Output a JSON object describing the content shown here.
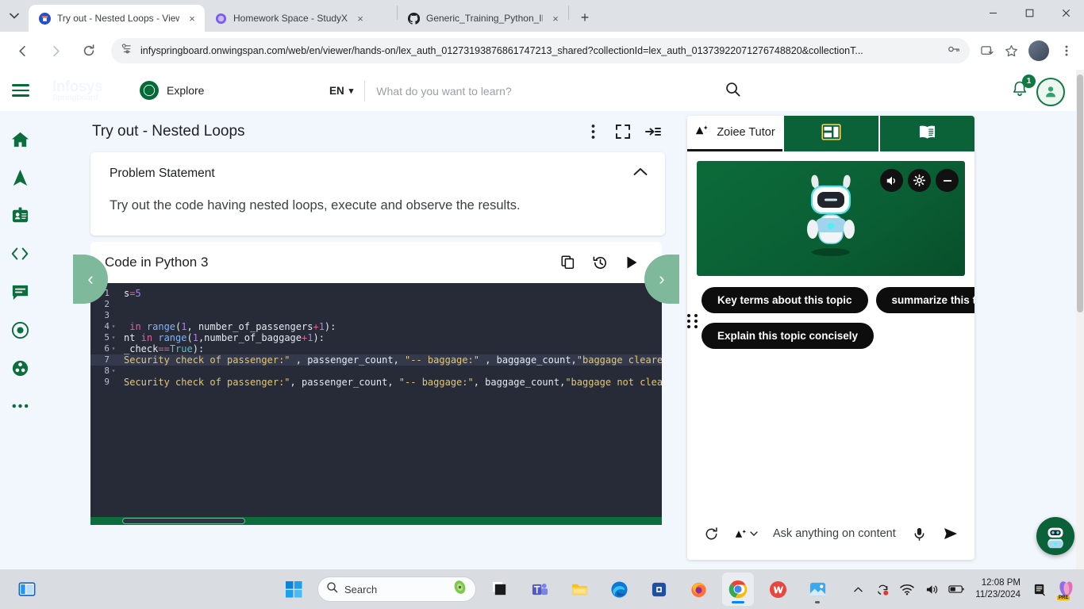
{
  "browser": {
    "tabs": [
      {
        "title": "Try out - Nested Loops - Viewer",
        "favicon": "infosys-springboard-icon",
        "active": true,
        "close_label": "×"
      },
      {
        "title": "Homework Space - StudyX",
        "favicon": "studyx-icon",
        "active": false,
        "close_label": "×"
      },
      {
        "title": "Generic_Training_Python_INFY/P",
        "favicon": "github-icon",
        "active": false,
        "close_label": "×"
      }
    ],
    "new_tab_label": "+",
    "window_controls": {
      "minimize": "—",
      "maximize": "☐",
      "close": "✕"
    },
    "url": "infyspringboard.onwingspan.com/web/en/viewer/hands-on/lex_auth_01273193876861747213_shared?collectionId=lex_auth_01373922071276748820&collectionT...",
    "nav": {
      "back": "back-arrow-icon",
      "forward": "forward-arrow-icon",
      "reload": "reload-icon"
    },
    "omnibox_icons": [
      "site-settings-icon",
      "password-key-icon"
    ],
    "toolbar_icons": [
      "install-app-icon",
      "bookmark-star-icon",
      "profile-avatar",
      "chrome-menu-icon"
    ]
  },
  "app": {
    "brand_line1": "Infosys",
    "brand_line2": "Springboard",
    "menu_icon": "hamburger-menu-icon",
    "explore_label": "Explore",
    "explore_icon": "compass-icon",
    "language": "EN",
    "language_caret": "▾",
    "search_placeholder": "What do you want to learn?",
    "search_value": "",
    "search_icon": "search-icon",
    "notification_count": "1",
    "notification_icon": "bell-icon",
    "avatar_icon": "user-avatar"
  },
  "sidebar": {
    "items": [
      {
        "name": "home",
        "icon": "home-icon"
      },
      {
        "name": "navigate",
        "icon": "navigation-arrow-icon"
      },
      {
        "name": "credentials",
        "icon": "id-badge-icon"
      },
      {
        "name": "code",
        "icon": "code-brackets-icon"
      },
      {
        "name": "discussions",
        "icon": "chat-bubble-icon"
      },
      {
        "name": "goals",
        "icon": "target-icon"
      },
      {
        "name": "community",
        "icon": "group-icon"
      },
      {
        "name": "more",
        "icon": "more-horizontal-icon"
      }
    ]
  },
  "content": {
    "title": "Try out - Nested Loops",
    "header_icons": [
      "kebab-menu-icon",
      "fullscreen-icon",
      "collapse-panel-icon"
    ],
    "problem_statement": {
      "heading": "Problem Statement",
      "collapse_caret": "∧",
      "body": "Try out the code having nested loops, execute and observe the results."
    },
    "editor": {
      "title": "Code in Python 3",
      "toolbar_icons": [
        "copy-icon",
        "history-icon",
        "run-icon"
      ],
      "prev_label": "‹",
      "next_label": "›",
      "lines": [
        {
          "num": "1",
          "fold": "",
          "highlighted": false,
          "tokens": [
            {
              "t": "s",
              "c": "var"
            },
            {
              "t": "=",
              "c": "kw"
            },
            {
              "t": "5",
              "c": "num"
            }
          ]
        },
        {
          "num": "2",
          "fold": "",
          "highlighted": false,
          "tokens": []
        },
        {
          "num": "3",
          "fold": "",
          "highlighted": false,
          "tokens": []
        },
        {
          "num": "4",
          "fold": "▾",
          "highlighted": false,
          "tokens": [
            {
              "t": " in ",
              "c": "kw"
            },
            {
              "t": "range",
              "c": "fn"
            },
            {
              "t": "(",
              "c": "var"
            },
            {
              "t": "1",
              "c": "num"
            },
            {
              "t": ", number_of_passengers",
              "c": "var"
            },
            {
              "t": "+",
              "c": "kw"
            },
            {
              "t": "1",
              "c": "num"
            },
            {
              "t": "):",
              "c": "var"
            }
          ]
        },
        {
          "num": "5",
          "fold": "▾",
          "highlighted": false,
          "tokens": [
            {
              "t": "nt",
              "c": "var"
            },
            {
              "t": " in ",
              "c": "kw"
            },
            {
              "t": "range",
              "c": "fn"
            },
            {
              "t": "(",
              "c": "var"
            },
            {
              "t": "1",
              "c": "num"
            },
            {
              "t": ",number_of_baggage",
              "c": "var"
            },
            {
              "t": "+",
              "c": "kw"
            },
            {
              "t": "1",
              "c": "num"
            },
            {
              "t": "):",
              "c": "var"
            }
          ]
        },
        {
          "num": "6",
          "fold": "▾",
          "highlighted": false,
          "tokens": [
            {
              "t": "_check",
              "c": "var"
            },
            {
              "t": "==",
              "c": "kw"
            },
            {
              "t": "True",
              "c": "bool"
            },
            {
              "t": "):",
              "c": "var"
            }
          ]
        },
        {
          "num": "7",
          "fold": "",
          "highlighted": true,
          "tokens": [
            {
              "t": "Security check of passenger:\" ",
              "c": "str"
            },
            {
              "t": ", passenger_count, ",
              "c": "var"
            },
            {
              "t": "\"-- baggage:\" ",
              "c": "str"
            },
            {
              "t": ", baggage_count,",
              "c": "var"
            },
            {
              "t": "\"baggage cleared\"",
              "c": "str"
            },
            {
              "t": ")",
              "c": "var"
            }
          ]
        },
        {
          "num": "8",
          "fold": "▾",
          "highlighted": false,
          "tokens": []
        },
        {
          "num": "9",
          "fold": "",
          "highlighted": false,
          "tokens": [
            {
              "t": "Security check of passenger:\"",
              "c": "str"
            },
            {
              "t": ", passenger_count, ",
              "c": "var"
            },
            {
              "t": "\"-- baggage:\"",
              "c": "str"
            },
            {
              "t": ", baggage_count,",
              "c": "var"
            },
            {
              "t": "\"baggage not cleared\"",
              "c": "str"
            },
            {
              "t": ")",
              "c": "var"
            }
          ]
        }
      ]
    }
  },
  "tutor": {
    "tabs": [
      {
        "label": "Zoiee Tutor",
        "icon": "ai-sparkle-icon",
        "active": true
      },
      {
        "label": "",
        "icon": "flashcard-icon",
        "active": false
      },
      {
        "label": "",
        "icon": "book-icon",
        "active": false
      }
    ],
    "stage_controls": [
      "speaker-icon",
      "gear-icon",
      "minimize-icon"
    ],
    "avatar_icon": "robot-avatar",
    "chips": [
      "Key terms about this topic",
      "summarize this topic",
      "Explain this topic concisely"
    ],
    "grip_icon": "drag-grip-icon",
    "ask": {
      "refresh_icon": "refresh-icon",
      "model_icon": "ai-sparkle-icon",
      "model_caret": "⌄",
      "placeholder": "Ask anything on content",
      "value": "",
      "mic_icon": "microphone-icon",
      "send_icon": "send-icon"
    },
    "fab_icon": "robot-assistant-fab"
  },
  "taskbar": {
    "task_view_icon": "task-view-icon",
    "start_icon": "windows-start-icon",
    "search_placeholder": "Search",
    "search_icon": "search-icon",
    "apps": [
      {
        "name": "copilot",
        "icon": "copilot-icon"
      },
      {
        "name": "teams",
        "icon": "microsoft-teams-icon"
      },
      {
        "name": "file-explorer",
        "icon": "file-explorer-icon"
      },
      {
        "name": "edge",
        "icon": "microsoft-edge-icon"
      },
      {
        "name": "store",
        "icon": "microsoft-store-icon"
      },
      {
        "name": "firefox",
        "icon": "firefox-icon"
      },
      {
        "name": "chrome",
        "icon": "google-chrome-icon"
      },
      {
        "name": "wps-office",
        "icon": "wps-office-icon"
      },
      {
        "name": "photos",
        "icon": "photos-icon"
      }
    ],
    "tray": {
      "chevron_icon": "show-hidden-icons-icon",
      "onedrive_icon": "onedrive-sync-icon",
      "wifi_icon": "wifi-icon",
      "volume_icon": "volume-icon",
      "battery_icon": "battery-icon",
      "time": "12:08 PM",
      "date": "11/23/2024",
      "notes_icon": "notes-icon",
      "pre_icon": "copilot-pre-icon"
    }
  },
  "colors": {
    "brand_green": "#046a38",
    "tab_green": "#0b6238",
    "editor_bg": "#272b38",
    "chrome_grey": "#dee1e6",
    "page_bg": "#f2f7fd"
  }
}
